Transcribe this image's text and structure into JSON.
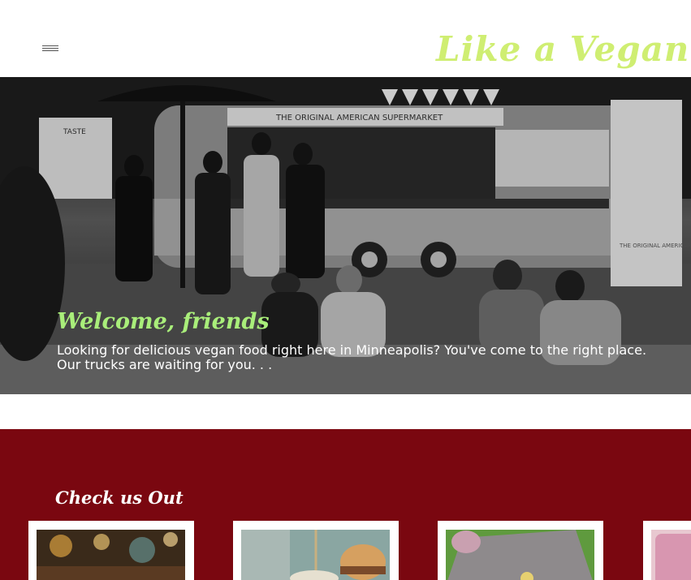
{
  "header": {
    "menu_icon": "hamburger-menu-icon",
    "logo_text": "Like a Vegan",
    "logo_color": "#cfee72"
  },
  "hero": {
    "title": "Welcome, friends",
    "body": "Looking for delicious vegan food right here in Minneapolis? You've come to the right place. Our trucks are waiting for you. . .",
    "photo_signage": {
      "banner": "THE ORIGINAL AMERICAN SUPERMARKET",
      "brand": "TASTE",
      "sidebar_sign": "THE ORIGINAL AMERICAN SUPERMARKET"
    },
    "title_color": "#a9ee7a"
  },
  "section": {
    "title": "Check us Out",
    "background": "#7a0710",
    "cards": [
      {
        "name": "card-1",
        "image": "blurred-market-lights-photo"
      },
      {
        "name": "card-2",
        "image": "burger-on-skewer-photo"
      },
      {
        "name": "card-3",
        "image": "picnic-blanket-photo"
      },
      {
        "name": "card-4",
        "image": "pink-smoothie-photo"
      }
    ]
  }
}
